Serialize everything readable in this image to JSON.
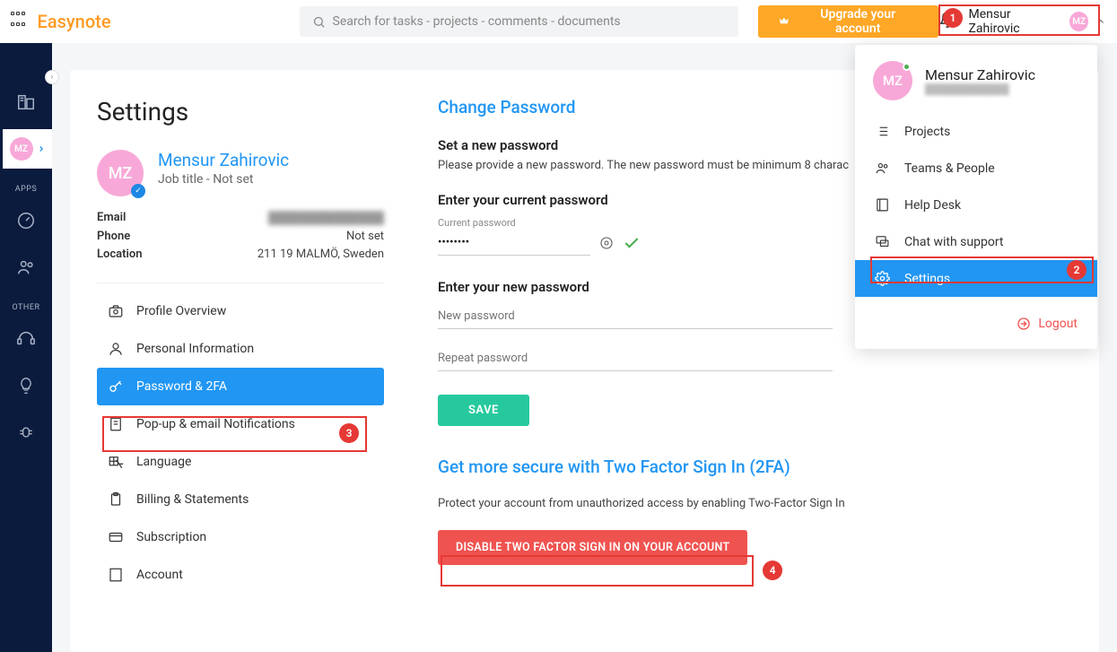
{
  "brand": "Easynote",
  "search_placeholder": "Search for tasks - projects - comments - documents",
  "upgrade_label": "Upgrade your account",
  "topbar_user_name": "Mensur Zahirovic",
  "avatar_initials": "MZ",
  "leftnav": {
    "apps_label": "APPS",
    "other_label": "OTHER"
  },
  "settings": {
    "title": "Settings",
    "profile_name": "Mensur Zahirovic",
    "profile_sub": "Job title - Not set",
    "info": {
      "email_label": "Email",
      "email_value": "██████████████",
      "phone_label": "Phone",
      "phone_value": "Not set",
      "location_label": "Location",
      "location_value": "211 19 MALMÖ, Sweden"
    },
    "nav": [
      "Profile Overview",
      "Personal Information",
      "Password & 2FA",
      "Pop-up & email Notifications",
      "Language",
      "Billing & Statements",
      "Subscription",
      "Account"
    ]
  },
  "password_section": {
    "heading": "Change Password",
    "set_heading": "Set a new password",
    "set_text": "Please provide a new password. The new password must be minimum 8 charac",
    "enter_current_heading": "Enter your current password",
    "current_hint": "Current password",
    "current_value": "••••••••",
    "enter_new_heading": "Enter your new password",
    "new_placeholder": "New password",
    "repeat_placeholder": "Repeat password",
    "save_label": "SAVE",
    "twofa_heading": "Get more secure with Two Factor Sign In (2FA)",
    "twofa_text": "Protect your account from unauthorized access by enabling Two-Factor Sign In",
    "disable_label": "DISABLE TWO FACTOR SIGN IN ON YOUR ACCOUNT"
  },
  "dropdown": {
    "name": "Mensur Zahirovic",
    "sub": "████████████",
    "items": [
      "Projects",
      "Teams & People",
      "Help Desk",
      "Chat with support",
      "Settings"
    ],
    "logout": "Logout"
  },
  "annotations": {
    "a1": "1",
    "a2": "2",
    "a3": "3",
    "a4": "4"
  }
}
